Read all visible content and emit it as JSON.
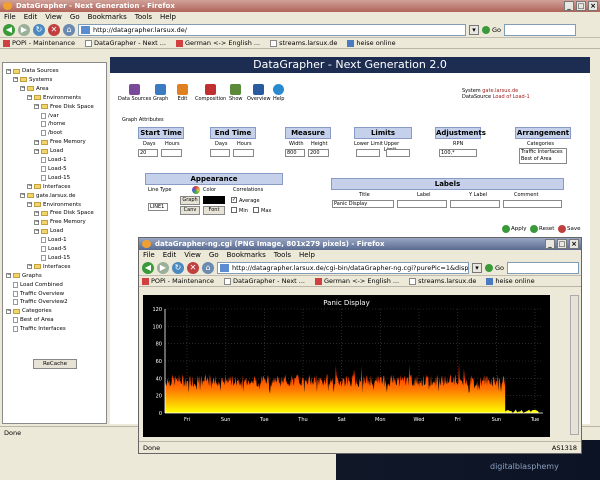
{
  "window": {
    "title": "DataGrapher - Next Generation - Firefox",
    "menu": [
      "File",
      "Edit",
      "View",
      "Go",
      "Bookmarks",
      "Tools",
      "Help"
    ],
    "url": "http://datagrapher.larsux.de/",
    "go_label": "Go",
    "bookmarks": [
      "POPi - Maintenance",
      "DataGrapher - Next ...",
      "German <-> English ...",
      "streams.larsux.de",
      "heise online"
    ],
    "status": "Done"
  },
  "tree": {
    "nodes": [
      {
        "label": "Data Sources",
        "depth": 0,
        "kind": "folder"
      },
      {
        "label": "Systems",
        "depth": 1,
        "kind": "folder"
      },
      {
        "label": "Area",
        "depth": 2,
        "kind": "folder"
      },
      {
        "label": "Environments",
        "depth": 3,
        "kind": "folder"
      },
      {
        "label": "Free Disk Space",
        "depth": 4,
        "kind": "folder"
      },
      {
        "label": "/var",
        "depth": 5,
        "kind": "leaf"
      },
      {
        "label": "/home",
        "depth": 5,
        "kind": "leaf"
      },
      {
        "label": "/boot",
        "depth": 5,
        "kind": "leaf"
      },
      {
        "label": "Free Memory",
        "depth": 4,
        "kind": "folder"
      },
      {
        "label": "Load",
        "depth": 4,
        "kind": "folder"
      },
      {
        "label": "Load-1",
        "depth": 5,
        "kind": "leaf"
      },
      {
        "label": "Load-5",
        "depth": 5,
        "kind": "leaf"
      },
      {
        "label": "Load-15",
        "depth": 5,
        "kind": "leaf"
      },
      {
        "label": "Interfaces",
        "depth": 3,
        "kind": "folder"
      },
      {
        "label": "gate.larsux.de",
        "depth": 2,
        "kind": "folder"
      },
      {
        "label": "Environments",
        "depth": 3,
        "kind": "folder"
      },
      {
        "label": "Free Disk Space",
        "depth": 4,
        "kind": "folder"
      },
      {
        "label": "Free Memory",
        "depth": 4,
        "kind": "folder"
      },
      {
        "label": "Load",
        "depth": 4,
        "kind": "folder"
      },
      {
        "label": "Load-1",
        "depth": 5,
        "kind": "leaf"
      },
      {
        "label": "Load-5",
        "depth": 5,
        "kind": "leaf"
      },
      {
        "label": "Load-15",
        "depth": 5,
        "kind": "leaf"
      },
      {
        "label": "Interfaces",
        "depth": 3,
        "kind": "folder"
      },
      {
        "label": "Graphs",
        "depth": 0,
        "kind": "folder"
      },
      {
        "label": "Load Combined",
        "depth": 1,
        "kind": "doc"
      },
      {
        "label": "Traffic Overview",
        "depth": 1,
        "kind": "doc"
      },
      {
        "label": "Traffic Overview2",
        "depth": 1,
        "kind": "doc"
      },
      {
        "label": "Categories",
        "depth": 0,
        "kind": "folder"
      },
      {
        "label": "Best of Area",
        "depth": 1,
        "kind": "doc"
      },
      {
        "label": "Traffic Interfaces",
        "depth": 1,
        "kind": "doc"
      }
    ],
    "recache_label": "ReCache"
  },
  "app": {
    "header": "DataGrapher - Next Generation 2.0",
    "tools": [
      {
        "label": "Data Sources",
        "color": "#7a4a9a"
      },
      {
        "label": "Graph",
        "color": "#3a7ac0"
      },
      {
        "label": "Edit",
        "color": "#e08020"
      },
      {
        "label": "Composition",
        "color": "#c03030"
      },
      {
        "label": "Show",
        "color": "#5a8a3a"
      },
      {
        "label": "Overview",
        "color": "#2a5aa0"
      },
      {
        "label": "Help",
        "color": "#2a8ad0"
      }
    ],
    "system_label": "System",
    "system_value": "gate.larsux.de",
    "datasource_label": "DataSource",
    "datasource_value": "Load of Load-1",
    "attributes_label": "Graph Attributes",
    "start_time": {
      "title": "Start Time",
      "days_label": "Days",
      "hours_label": "Hours",
      "days_value": "20"
    },
    "end_time": {
      "title": "End Time",
      "days_label": "Days",
      "hours_label": "Hours"
    },
    "measure": {
      "title": "Measure",
      "width_label": "Width",
      "height_label": "Height",
      "width_value": "800",
      "height_value": "200"
    },
    "limits": {
      "title": "Limits",
      "lower_label": "Lower Limit",
      "upper_label": "Upper Limit"
    },
    "adjustments": {
      "title": "Adjustments",
      "rpn_label": "RPN",
      "rpn_value": "100,*"
    },
    "arrangement": {
      "title": "Arrangement",
      "categories_label": "Categories",
      "options": [
        "Traffic Interfaces",
        "Best of Area"
      ]
    },
    "appearance": {
      "title": "Appearance",
      "linetype_label": "Line Type",
      "color_label": "Color",
      "correlations_label": "Correlations",
      "linetype_value": "LINE1",
      "graph_btn": "Graph",
      "canv_btn": "Canv",
      "font_btn": "Font",
      "average_label": "Average",
      "min_label": "Min",
      "max_label": "Max"
    },
    "labels": {
      "title": "Labels",
      "title_label": "Title",
      "label_label": "Label",
      "ylabel_label": "Y Label",
      "comment_label": "Comment",
      "title_value": "Panic Display"
    },
    "apply_label": "Apply",
    "reset_label": "Reset",
    "save_label": "Save"
  },
  "popup": {
    "title": "dataGrapher-ng.cgi (PNG Image, 801x279 pixels) - Firefox",
    "menu": [
      "File",
      "Edit",
      "View",
      "Go",
      "Bookmarks",
      "Tools",
      "Help"
    ],
    "url": "http://datagrapher.larsux.de/cgi-bin/dataGrapher-ng.cgi?purePic=1&displ",
    "go_label": "Go",
    "bookmarks": [
      "POPi - Maintenance",
      "DataGrapher - Next ...",
      "German <-> English ...",
      "streams.larsux.de",
      "heise online"
    ],
    "status": "Done",
    "status_right": "AS1318"
  },
  "desktop_text": "digitalblasphemy",
  "chart_data": {
    "type": "area",
    "title": "Panic Display",
    "ylim": [
      0,
      120
    ],
    "yticks": [
      0,
      20,
      40,
      60,
      80,
      100,
      120
    ],
    "xticks": [
      "Fri",
      "Sun",
      "Tue",
      "Thu",
      "Sat",
      "Mon",
      "Wed",
      "Fri",
      "Sun",
      "Tue"
    ],
    "data_end_fraction": 0.9,
    "baseline_level": 22,
    "typical_range": [
      30,
      45
    ],
    "peak_level": 50,
    "grid": true,
    "colors": {
      "background": "#000000",
      "fill_top": "#ff0000",
      "fill_bottom": "#ffff00"
    }
  }
}
